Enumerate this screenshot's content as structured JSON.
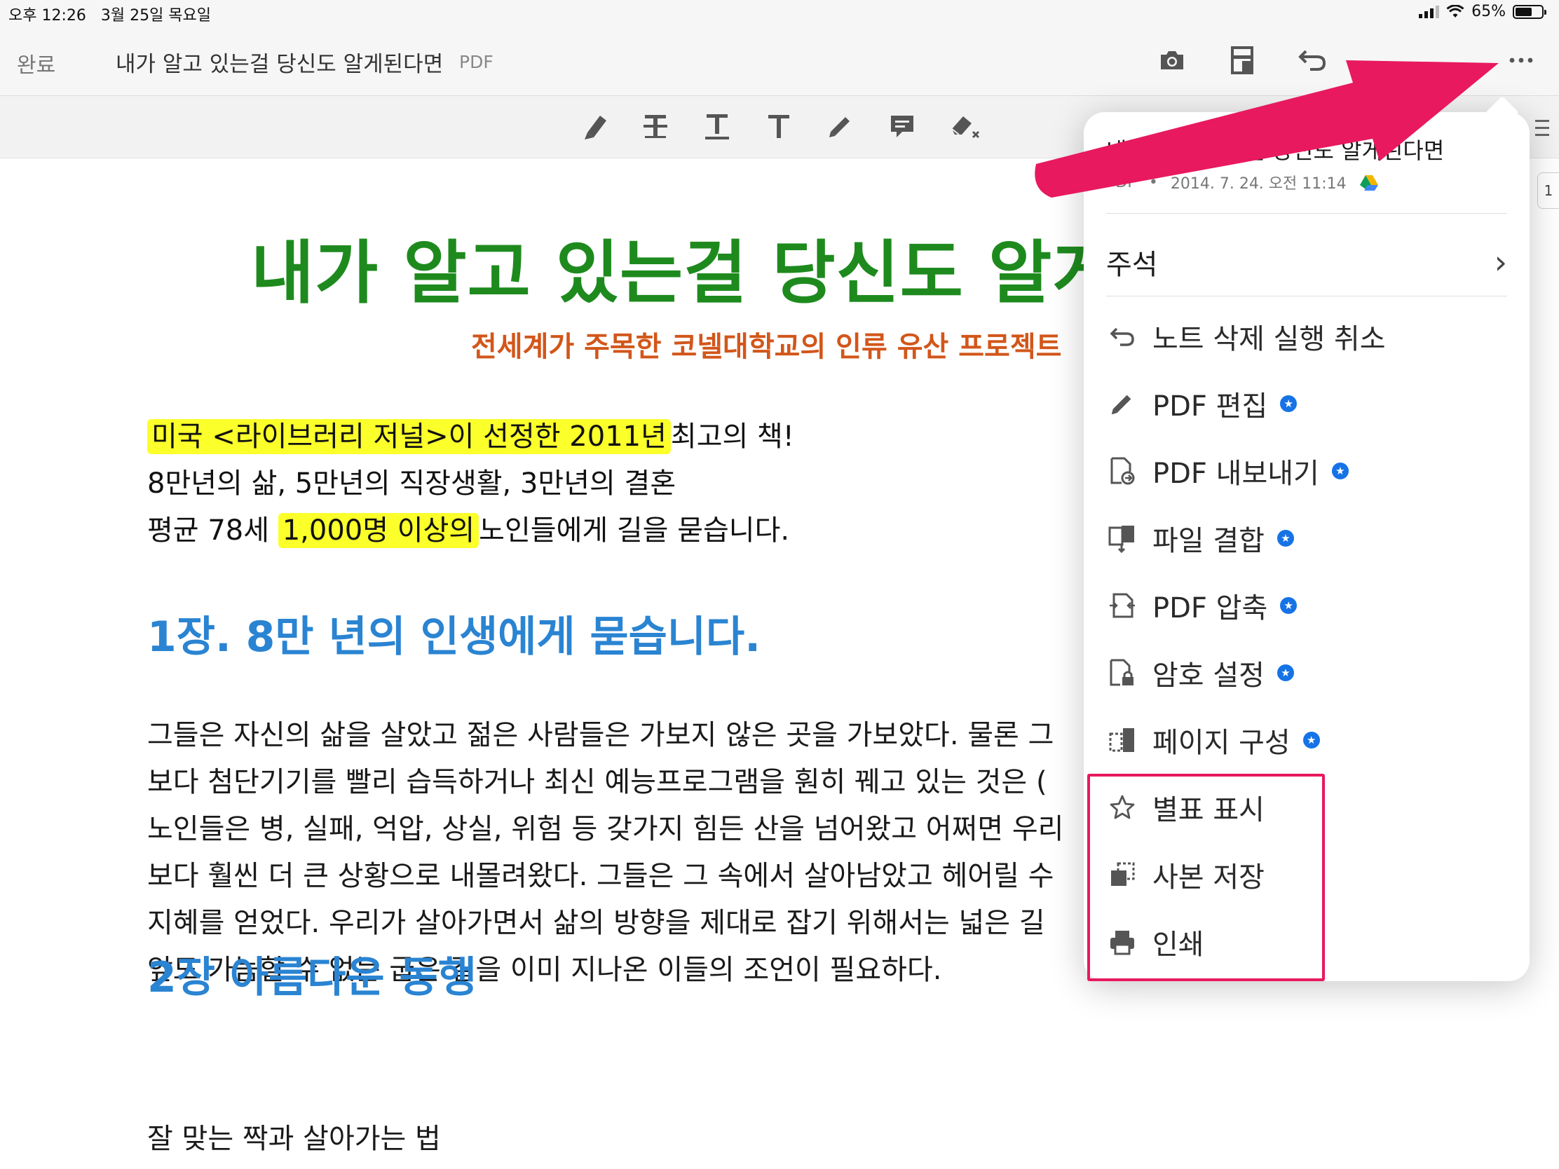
{
  "status_bar": {
    "time_date": "오후 12:26   3월 25일 목요일",
    "battery_text": "65%",
    "battery_level": 0.65
  },
  "nav": {
    "done_label": "완료",
    "title": "내가 알고 있는걸 당신도 알게된다면",
    "type": "PDF",
    "icons": [
      "camera-icon",
      "scan-icon",
      "undo-icon",
      "more-icon"
    ]
  },
  "toolbar": {
    "tools": [
      "highlight-icon",
      "strikethrough-icon",
      "underline-icon",
      "text-icon",
      "pencil-icon",
      "comment-icon",
      "eraser-icon"
    ]
  },
  "document": {
    "heading": "내가 알고 있는걸 당신도 알게",
    "subheading": "전세계가 주목한 코넬대학교의 인류 유산 프로젝트",
    "intro_line1_highlight": "미국 <라이브러리 저널>이 선정한 2011년",
    "intro_line1_rest": "최고의 책!",
    "intro_line2": "8만년의 삶, 5만년의 직장생활, 3만년의 결혼",
    "intro_line3_pre": "평균 78세",
    "intro_line3_highlight": "1,000명 이상의",
    "intro_line3_post": "노인들에게 길을 묻습니다.",
    "chapter1": "1장. 8만 년의 인생에게 묻습니다.",
    "paragraph": [
      "그들은 자신의 삶을 살았고 젊은 사람들은 가보지 않은 곳을 가보았다. 물론 그",
      "보다 첨단기기를 빨리 습득하거나 최신 예능프로그램을 훤히 꿰고 있는 것은 (",
      "노인들은 병, 실패, 억압, 상실, 위험 등 갖가지 힘든 산을 넘어왔고 어쩌면 우리",
      "보다 훨씬 더 큰 상황으로 내몰려왔다. 그들은 그 속에서 살아남았고 헤어릴 수",
      "지혜를 얻었다. 우리가 살아가면서 삶의 방향을 제대로 잡기 위해서는 넓은 길",
      "앞도 가늠할 수 없는 굽은 길을 이미 지나온 이들의 조언이 필요하다."
    ],
    "chapter2": "2장 아름다운 동행",
    "tail": "잘 맞는 짝과 살아가는 법"
  },
  "side": {
    "page_number": "1"
  },
  "popover": {
    "title": "내가 알고 있는걸 당신도 알게된다면",
    "meta_type": "PDF",
    "meta_dot": "•",
    "meta_date": "2014. 7. 24. 오전 11:14",
    "notes_label": "주석",
    "notes_chevron": "›",
    "premium_glyph": "★",
    "items": [
      {
        "label": "노트 삭제 실행 취소",
        "icon": "undo-icon",
        "premium": false
      },
      {
        "label": "PDF 편집",
        "icon": "pencil-icon",
        "premium": true
      },
      {
        "label": "PDF 내보내기",
        "icon": "export-pdf-icon",
        "premium": true
      },
      {
        "label": "파일 결합",
        "icon": "combine-files-icon",
        "premium": true
      },
      {
        "label": "PDF 압축",
        "icon": "compress-pdf-icon",
        "premium": true
      },
      {
        "label": "암호 설정",
        "icon": "lock-pdf-icon",
        "premium": true
      },
      {
        "label": "페이지 구성",
        "icon": "organize-pages-icon",
        "premium": true
      },
      {
        "label": "별표 표시",
        "icon": "star-icon",
        "premium": false
      },
      {
        "label": "사본 저장",
        "icon": "save-copy-icon",
        "premium": false
      },
      {
        "label": "인쇄",
        "icon": "print-icon",
        "premium": false
      }
    ]
  },
  "colors": {
    "heading": "#1e8a1e",
    "subheading": "#d2561a",
    "chapter": "#2a84d2",
    "highlight": "#fbff2a",
    "annotation_pink": "#e8195f",
    "premium_badge": "#1673e6"
  }
}
